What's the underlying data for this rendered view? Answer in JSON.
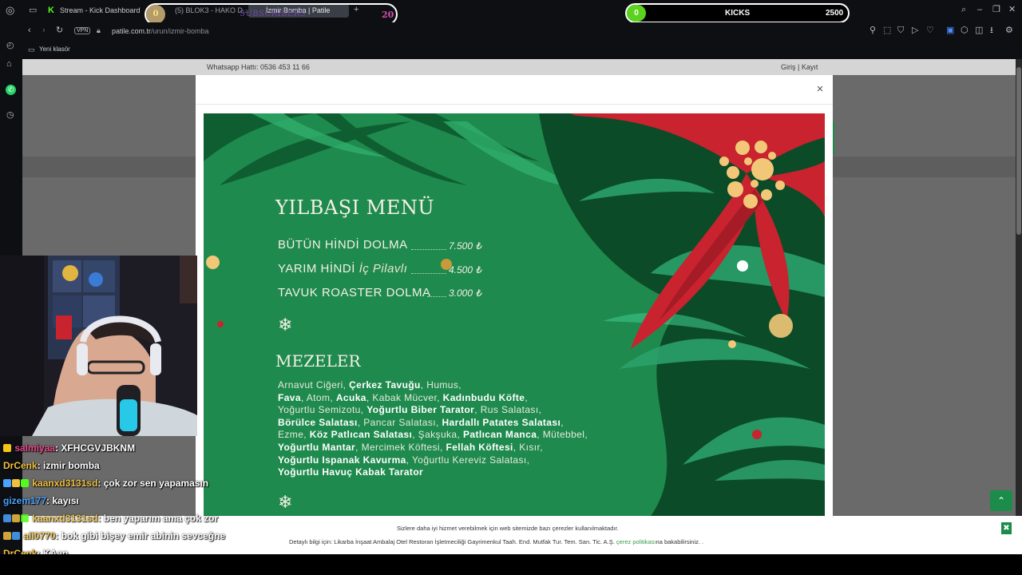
{
  "browser": {
    "tab1_label": "Stream - Kick Dashboard",
    "tab2_label": "(5) BLOK3 - HAKO D...",
    "tab3_label": "İzmir Bomba | Patile",
    "url_prefix": "patile.com.tr",
    "url_path": "/urun/izmir-bomba",
    "vpn_label": "VPN",
    "bookmark_folder": "Yeni klasör"
  },
  "overlays": {
    "subs_count": "0",
    "subs_title": "SUBSCRIBERS",
    "subs_goal": "20",
    "kicks_count": "0",
    "kicks_label": "KICKS",
    "kicks_goal": "2500"
  },
  "site": {
    "whatsapp_line": "Whatsapp Hattı: 0536 453 11 66",
    "login_label": "Giriş | Kayıt"
  },
  "modal": {
    "close_label": "×"
  },
  "menu": {
    "title": "YILBAŞI MENÜ",
    "items": [
      {
        "name": "BÜTÜN HİNDİ DOLMA",
        "extra": "",
        "price": "7.500 ₺"
      },
      {
        "name": "YARIM HİNDİ",
        "extra": "İç Pilavlı",
        "price": "4.500 ₺"
      },
      {
        "name": "TAVUK ROASTER DOLMA",
        "extra": "",
        "price": "3.000 ₺"
      }
    ],
    "snowflake": "❄",
    "mezeler_title": "MEZELER",
    "mezeler_lines": [
      [
        "Arnavut Ciğeri, ",
        "Çerkez Tavuğu",
        ", Humus,"
      ],
      [
        "Fava",
        ", Atom, ",
        "Acuka",
        ", Kabak Mücver, ",
        "Kadınbudu Köfte",
        ","
      ],
      [
        "Yoğurtlu Semizotu, ",
        "Yoğurtlu Biber Tarator",
        ", Rus Salatası,"
      ],
      [
        "Börülce Salatası",
        ", Pancar Salatası, ",
        "Hardallı Patates Salatası",
        ","
      ],
      [
        "Ezme, ",
        "Köz Patlıcan Salatası",
        ", Şakşuka, ",
        "Patlıcan Manca",
        ", Mütebbel,"
      ],
      [
        "Yoğurtlu Mantar",
        ", Mercimek Köftesi, ",
        "Fellah Köftesi",
        ", Kısır,"
      ],
      [
        "Yoğurtlu Ispanak Kavurma",
        ", Yoğurtlu Kereviz Salatası,"
      ],
      [
        "Yoğurtlu Havuç Kabak Tarator"
      ]
    ]
  },
  "cookie": {
    "line1": "Sizlere daha iyi hizmet verebilmek için web sitemizde bazı çerezler kullanılmaktadır.",
    "line2_prefix": "Detaylı bilgi için: Likarba İnşaat Ambalaj Otel Restoran İşletmeciliği Gayrimenkul Taah. End. Mutfak Tur. Tem. San. Tic. A.Ş. ",
    "line2_link": "çerez politikası",
    "line2_suffix": "na bakabilirsiniz. .",
    "close_label": "✖"
  },
  "chat": [
    {
      "user": "salmiyaa",
      "msg": ": XFHCGVJBKNM",
      "color": "#e84a8a"
    },
    {
      "user": "DrCenk",
      "msg": ": izmir bomba",
      "color": "#f0c040"
    },
    {
      "user": "kaanxd3131sd",
      "msg": ": çok zor sen yapamasın",
      "color": "#f0c040"
    },
    {
      "user": "gizem177",
      "msg": ": kayısı",
      "color": "#4aa3ff"
    },
    {
      "user": "kaanxd3131sd",
      "msg": ": ben yaparım ama çok zor",
      "color": "#f0c040"
    },
    {
      "user": "ali0770",
      "msg": ": bok gibi bişey emir abinin sevceğne",
      "color": "#f0c040"
    },
    {
      "user": "DrCenk",
      "msg": ": KAan",
      "color": "#f0c040"
    }
  ]
}
